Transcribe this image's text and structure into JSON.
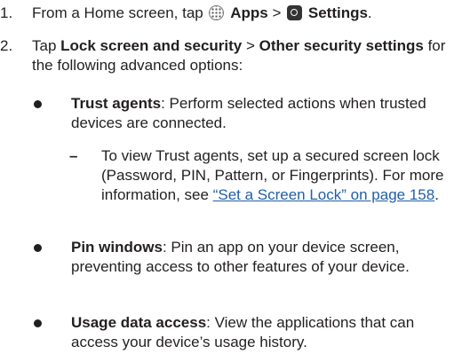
{
  "steps": [
    {
      "number": "1.",
      "text_1": "From a Home screen, tap",
      "apps_label": "Apps",
      "separator": ">",
      "settings_label": "Settings",
      "end": "."
    },
    {
      "number": "2.",
      "text_1": "Tap",
      "bold_1": "Lock screen and security",
      "separator": ">",
      "bold_2": "Other security settings",
      "text_2": "for the following advanced options:"
    }
  ],
  "options": [
    {
      "title": "Trust agents",
      "description": ": Perform selected actions when trusted devices are connected."
    },
    {
      "title": "Pin windows",
      "description": ": Pin an app on your device screen, preventing access to other features of your device."
    },
    {
      "title": "Usage data access",
      "description": ": View the applications that can access your device’s usage history."
    }
  ],
  "sub_note": {
    "mark": "–",
    "text": "To view Trust agents, set up a secured screen lock (Password, PIN, Pattern, or Fingerprints). For more information, see",
    "link": "“Set a Screen Lock” on page 158",
    "end": "."
  },
  "icons": {
    "apps": "apps-icon",
    "settings": "settings-gear-icon"
  },
  "colors": {
    "text": "#231f20",
    "link": "#1f5fa8"
  }
}
